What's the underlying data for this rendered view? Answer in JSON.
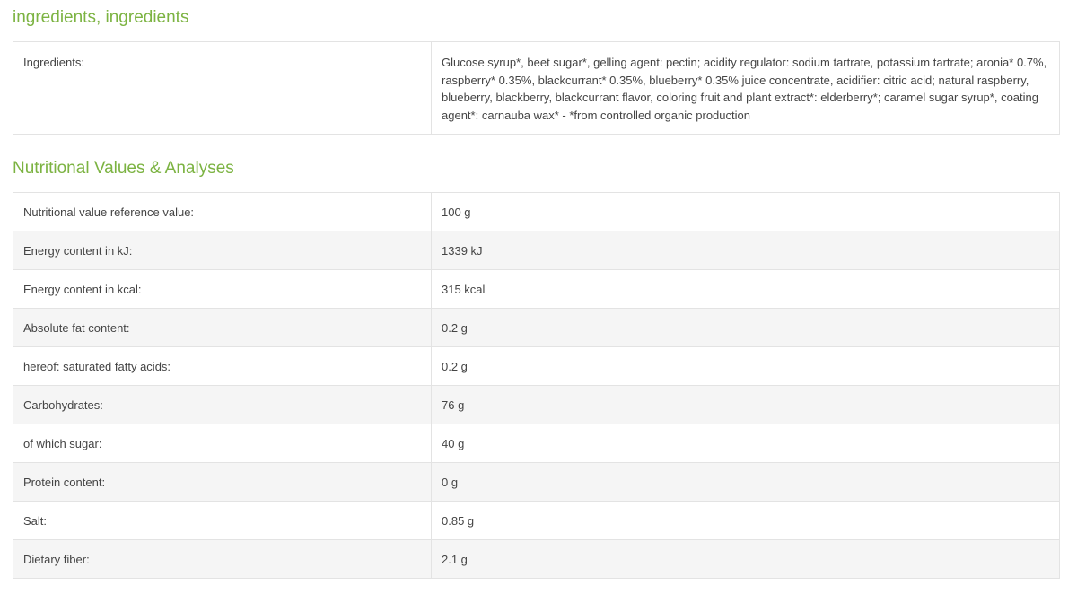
{
  "ingredients_section": {
    "title": "ingredients, ingredients",
    "label": "Ingredients:",
    "value": "Glucose syrup*, beet sugar*, gelling agent: pectin; acidity regulator: sodium tartrate, potassium tartrate; aronia* 0.7%, raspberry* 0.35%, blackcurrant* 0.35%, blueberry* 0.35% juice concentrate, acidifier: citric acid; natural raspberry, blueberry, blackberry, blackcurrant flavor, coloring fruit and plant extract*: elderberry*; caramel sugar syrup*, coating agent*: carnauba wax* - *from controlled organic production"
  },
  "nutrition_section": {
    "title": "Nutritional Values & Analyses",
    "rows": [
      {
        "label": "Nutritional value reference value:",
        "value": "100 g"
      },
      {
        "label": "Energy content in kJ:",
        "value": "1339 kJ"
      },
      {
        "label": "Energy content in kcal:",
        "value": "315 kcal"
      },
      {
        "label": "Absolute fat content:",
        "value": "0.2 g"
      },
      {
        "label": "hereof: saturated fatty acids:",
        "value": "0.2 g"
      },
      {
        "label": "Carbohydrates:",
        "value": "76 g"
      },
      {
        "label": "of which sugar:",
        "value": "40 g"
      },
      {
        "label": "Protein content:",
        "value": "0 g"
      },
      {
        "label": "Salt:",
        "value": "0.85 g"
      },
      {
        "label": "Dietary fiber:",
        "value": "2.1 g"
      }
    ]
  },
  "colors": {
    "accent": "#7cb342",
    "row_stripe": "#f5f5f5",
    "border": "#e3e3e3"
  }
}
